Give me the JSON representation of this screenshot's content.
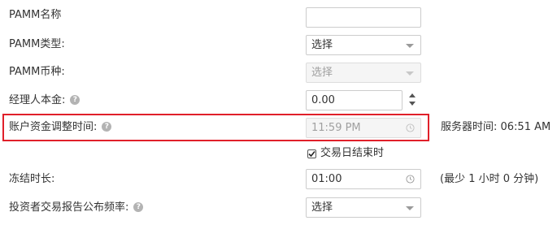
{
  "rows": {
    "pamm_name": {
      "label": "PAMM名称",
      "value": ""
    },
    "pamm_type": {
      "label": "PAMM类型:",
      "value": "选择"
    },
    "pamm_currency": {
      "label": "PAMM币种:",
      "value": "选择"
    },
    "manager_capital": {
      "label": "经理人本金:",
      "value": "0.00"
    },
    "rollover_time": {
      "label": "账户资金调整时间:",
      "value": "11:59 PM"
    },
    "freeze_duration": {
      "label": "冻结时长:",
      "value": "01:00"
    },
    "report_frequency": {
      "label": "投资者交易报告公布频率:",
      "value": "选择"
    }
  },
  "server_time_label": "服务器时间: 06:51 AM",
  "trading_day_end": {
    "label": "交易日结束时",
    "checked": true
  },
  "freeze_min_hint": "(最少 1 小时 0 分钟)",
  "help_glyph": "?",
  "icons": {
    "help": "question-circle-icon",
    "clock": "clock-icon",
    "caret": "chevron-down-icon",
    "spinner": "up-down-arrows-icon"
  },
  "colors": {
    "highlight_border": "#e0202a",
    "field_border": "#cccccc",
    "disabled_bg": "#f5f5f5"
  }
}
